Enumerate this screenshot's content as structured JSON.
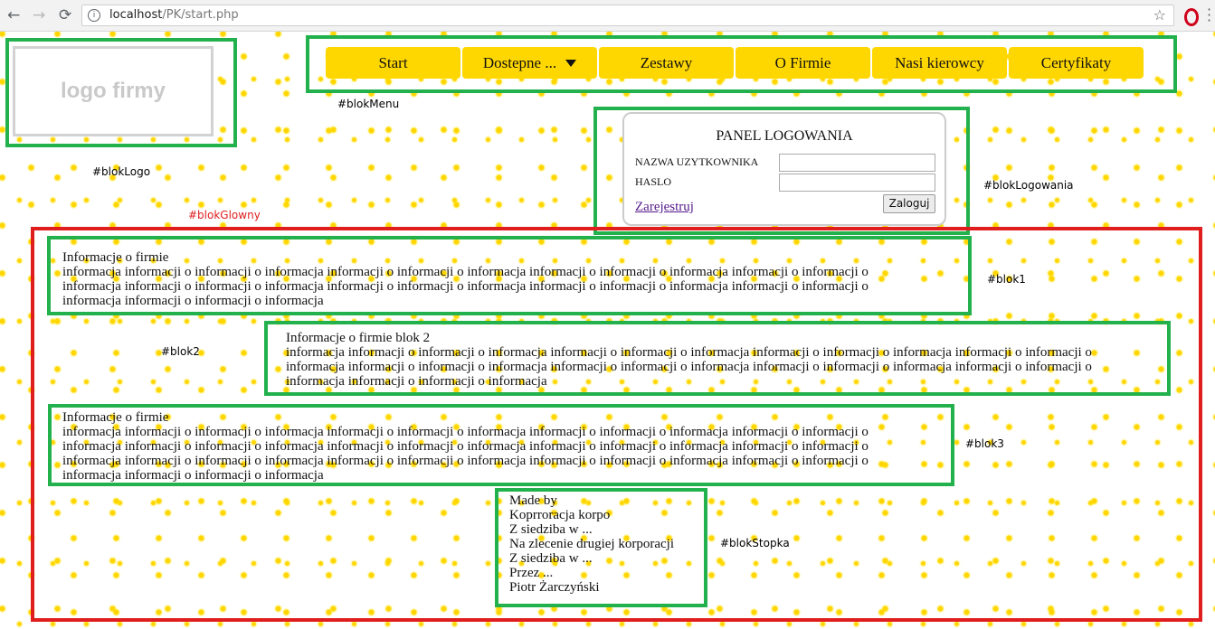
{
  "browser": {
    "url_host": "localhost",
    "url_path": "/PK/start.php",
    "back_glyph": "←",
    "forward_glyph": "→",
    "reload_glyph": "⟳",
    "star_glyph": "☆",
    "info_glyph": "i"
  },
  "logo": {
    "text": "logo firmy",
    "label": "#blokLogo"
  },
  "menu": {
    "label": "#blokMenu",
    "items": [
      "Start",
      "Dostepne ...",
      "Zestawy",
      "O Firmie",
      "Nasi kierowcy",
      "Certyfikaty"
    ]
  },
  "login": {
    "label": "#blokLogowania",
    "title": "PANEL LOGOWANIA",
    "username_label": "NAZWA UZYTKOWNIKA",
    "password_label": "HASLO",
    "register_link": "Zarejestruj",
    "submit_label": "Zaloguj"
  },
  "main_label": "#blokGlowny",
  "blocks": [
    {
      "label": "#blok1",
      "lines": [
        "Informacje o firmie",
        "informacja informacji o informacji o informacja informacji o informacji o informacja informacji o informacji o informacja informacji o informacji o",
        "informacja informacji o informacji o informacja informacji o informacji o informacja informacji o informacji o informacja informacji o informacji o",
        "informacja informacji o informacji o informacja"
      ]
    },
    {
      "label": "#blok2",
      "lines": [
        "Informacje o firmie blok 2",
        "informacja informacji o informacji o informacja informacji o informacji o informacja informacji o informacji o informacja informacji o informacji o",
        "informacja informacji o informacji o informacja informacji o informacji o informacja informacji o informacji o informacja informacji o informacji o",
        "informacja informacji o informacji o informacja"
      ]
    },
    {
      "label": "#blok3",
      "lines": [
        "Informacje o firmie",
        "informacja informacji o informacji o informacja informacji o informacji o informacja informacji o informacji o informacja informacji o informacji o",
        "informacja informacji o informacji o informacja informacji o informacji o informacja informacji o informacji o informacja informacji o informacji o",
        "informacja informacji o informacji o informacja informacji o informacji o informacja informacji o informacji o informacja informacji o informacji o",
        "informacja informacji o informacji o informacja"
      ]
    }
  ],
  "footer": {
    "label": "#blokStopka",
    "lines": [
      "Made by",
      "Koprroracja korpo",
      "Z siedziba w ...",
      "Na zlecenie drugiej korporacji",
      "Z siedziba w ...",
      "Przez ...",
      "Piotr Żarczyński"
    ]
  }
}
